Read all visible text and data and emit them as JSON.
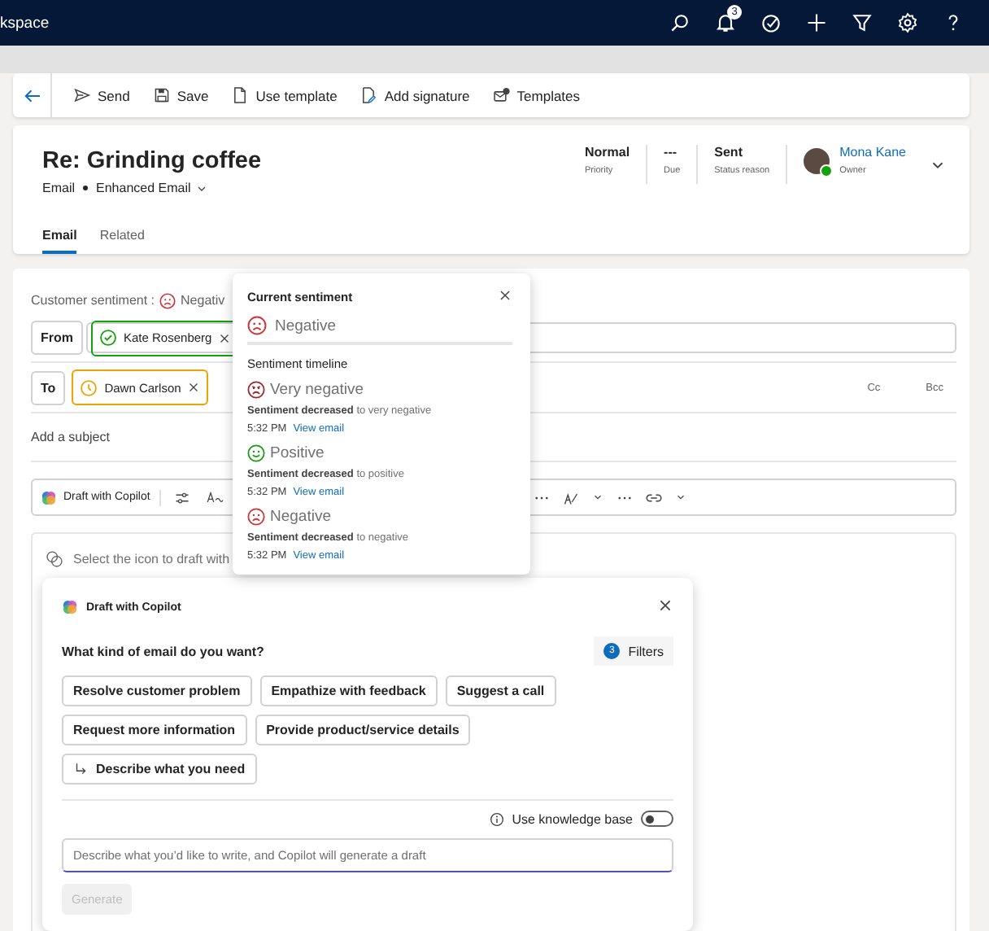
{
  "top_bar": {
    "app_name": "kspace",
    "notification_count": "3"
  },
  "command_bar": {
    "items": [
      {
        "label": "Send",
        "kind": "send"
      },
      {
        "label": "Save",
        "kind": "save"
      },
      {
        "label": "Use template",
        "kind": "template"
      },
      {
        "label": "Add signature",
        "kind": "signature"
      },
      {
        "label": "Templates",
        "kind": "templates"
      }
    ]
  },
  "header": {
    "title": "Re: Grinding coffee",
    "entity": "Email",
    "form_name": "Enhanced Email",
    "fields": [
      {
        "value": "Normal",
        "label": "Priority"
      },
      {
        "value": "---",
        "label": "Due"
      },
      {
        "value": "Sent",
        "label": "Status reason"
      }
    ],
    "owner": {
      "name": "Mona Kane",
      "label": "Owner",
      "online": true
    },
    "tabs": [
      {
        "label": "Email",
        "selected": true
      },
      {
        "label": "Related",
        "selected": false
      }
    ]
  },
  "form": {
    "sentiment": {
      "label": "Customer sentiment :",
      "kind": "negative",
      "value": "Negativ"
    },
    "from": {
      "label": "From",
      "recipient": {
        "name": "Kate Rosenberg",
        "kind": "resolved"
      }
    },
    "to": {
      "label": "To",
      "recipient": {
        "name": "Dawn Carlson",
        "kind": "pending"
      },
      "cc": "Cc",
      "bcc": "Bcc"
    },
    "subject_placeholder": "Add a subject",
    "toolbar": {
      "copilot_label": "Draft with Copilot"
    },
    "body_hint": "Select the icon to draft with"
  },
  "sentiment_popover": {
    "title": "Current sentiment",
    "current": {
      "kind": "negative",
      "label": "Negative"
    },
    "timeline_title": "Sentiment timeline",
    "timeline": [
      {
        "kind": "very_negative",
        "label": "Very negative",
        "detail": "**Sentiment decreased** to very negative",
        "time": "5:32 PM",
        "link": "View email"
      },
      {
        "kind": "positive",
        "label": "Positive",
        "detail": "**Sentiment decreased** to positive",
        "time": "5:32 PM",
        "link": "View email"
      },
      {
        "kind": "negative",
        "label": "Negative",
        "detail": "**Sentiment decreased** to negative",
        "time": "5:32 PM",
        "link": "View email"
      }
    ]
  },
  "copilot": {
    "title": "Draft with Copilot",
    "question": "What kind of email do you want?",
    "filters": {
      "count": "3",
      "label": "Filters"
    },
    "suggestions": [
      {
        "label": "Resolve customer problem",
        "kind": "preset"
      },
      {
        "label": "Empathize with feedback",
        "kind": "preset"
      },
      {
        "label": "Suggest a call",
        "kind": "preset"
      },
      {
        "label": "Request more information",
        "kind": "preset"
      },
      {
        "label": "Provide product/service details",
        "kind": "preset"
      },
      {
        "label": "Describe what you need",
        "kind": "custom"
      }
    ],
    "knowledge_base": {
      "label": "Use knowledge base",
      "on": false
    },
    "prompt_placeholder": "Describe what you’d like to write, and Copilot will generate a draft",
    "generate": {
      "label": "Generate",
      "disabled": true
    }
  }
}
